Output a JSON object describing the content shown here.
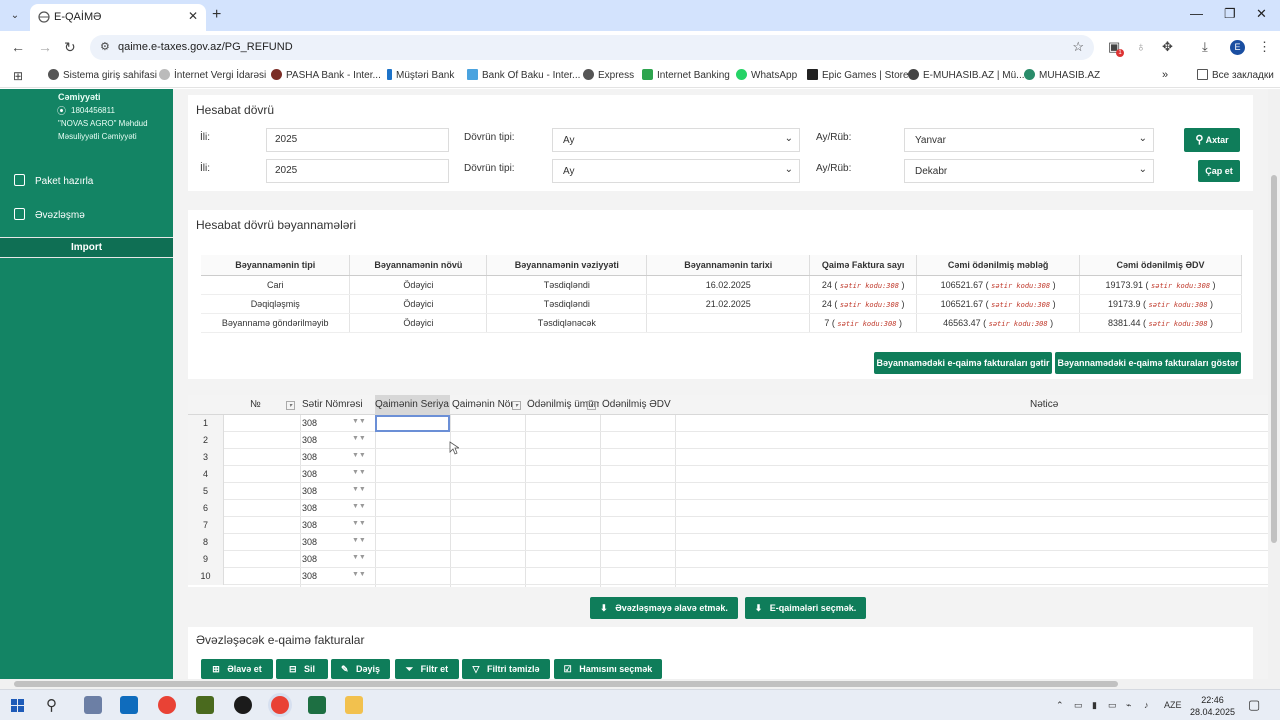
{
  "browser": {
    "tab_title": "E-QAİMƏ",
    "url": "qaime.e-taxes.gov.az/PG_REFUND",
    "bookmarks": [
      "Sistema giriş sahifasi",
      "İnternet Vergi İdarəsi",
      "PASHA Bank - Inter...",
      "Müştəri Bank",
      "Bank Of Baku - Inter...",
      "Express",
      "Internet Banking",
      "WhatsApp",
      "Epic Games | Store",
      "E-MUHASIB.AZ | Mü...",
      "MUHASIB.AZ"
    ],
    "bookmarks_folder": "Все закладки",
    "profile_letter": "E",
    "ext_badge": "1"
  },
  "sidebar": {
    "company_line1": "Cəmiyyəti",
    "tax_id": "1804456811",
    "company_line2": "\"NOVAS AGRO\" Məhdud",
    "company_line3": "Məsuliyyətli Cəmiyyəti",
    "items": [
      "Paket hazırla",
      "Əvəzləşmə"
    ],
    "import_label": "Import"
  },
  "period": {
    "title": "Hesabat dövrü",
    "rows": [
      {
        "year_label": "İli:",
        "year": "2025",
        "type_label": "Dövrün tipi:",
        "type": "Ay",
        "month_label": "Ay/Rüb:",
        "month": "Yanvar"
      },
      {
        "year_label": "İli:",
        "year": "2025",
        "type_label": "Dövrün tipi:",
        "type": "Ay",
        "month_label": "Ay/Rüb:",
        "month": "Dekabr"
      }
    ],
    "search_button": "Axtar",
    "print_button": "Çap et"
  },
  "declarations": {
    "title": "Hesabat dövrü bəyannamələri",
    "headers": [
      "Bəyannamənin tipi",
      "Bəyannamənin növü",
      "Bəyannamənin vəziyyəti",
      "Bəyannamənin tarixi",
      "Qaimə Faktura sayı",
      "Cəmi ödənilmiş məbləğ",
      "Cəmi ödənilmiş ƏDV"
    ],
    "rows": [
      {
        "tip": "Cari",
        "nov": "Ödəyici",
        "status": "Təsdiqləndi",
        "date": "16.02.2025",
        "count": "24",
        "amount": "106521.67",
        "vat": "19173.91"
      },
      {
        "tip": "Dəqiqləşmiş",
        "nov": "Ödəyici",
        "status": "Təsdiqləndi",
        "date": "21.02.2025",
        "count": "24",
        "amount": "106521.67",
        "vat": "19173.9"
      },
      {
        "tip": "Bəyannamə göndərilməyib",
        "nov": "Ödəyici",
        "status": "Təsdiqlənəcək",
        "date": "",
        "count": "7",
        "amount": "46563.47",
        "vat": "8381.44"
      }
    ],
    "code_note": "sətir kodu:308",
    "btn_fetch": "Bəyannamədəki e-qaimə fakturaları gətir",
    "btn_show": "Bəyannamədəki e-qaimə fakturaları göstər"
  },
  "grid": {
    "headers": [
      "№",
      "Sətir Nömrəsi",
      "Qaimənin Seriya",
      "Qaimənin Nömr",
      "Ödənilmiş ümüm",
      "Ödənilmiş ƏDV",
      "Nəticə"
    ],
    "row_numbers": [
      "1",
      "2",
      "3",
      "4",
      "5",
      "6",
      "7",
      "8",
      "9",
      "10"
    ],
    "row_code": "308"
  },
  "actions": {
    "btn_add_offset": "Əvəzləşməyə əlavə etmək.",
    "btn_select_invoices": "E-qaimələri seçmək."
  },
  "offset_section": {
    "title": "Əvəzləşəcək e-qaimə fakturalar",
    "toolbar": [
      "Əlavə et",
      "Sil",
      "Dəyiş",
      "Filtr et",
      "Filtri təmizlə",
      "Hamısını seçmək"
    ]
  },
  "taskbar": {
    "lang": "AZE",
    "time": "22:46",
    "date": "28.04.2025"
  },
  "colors": {
    "brand_green": "#138464",
    "button_green": "#0f7d5a"
  }
}
